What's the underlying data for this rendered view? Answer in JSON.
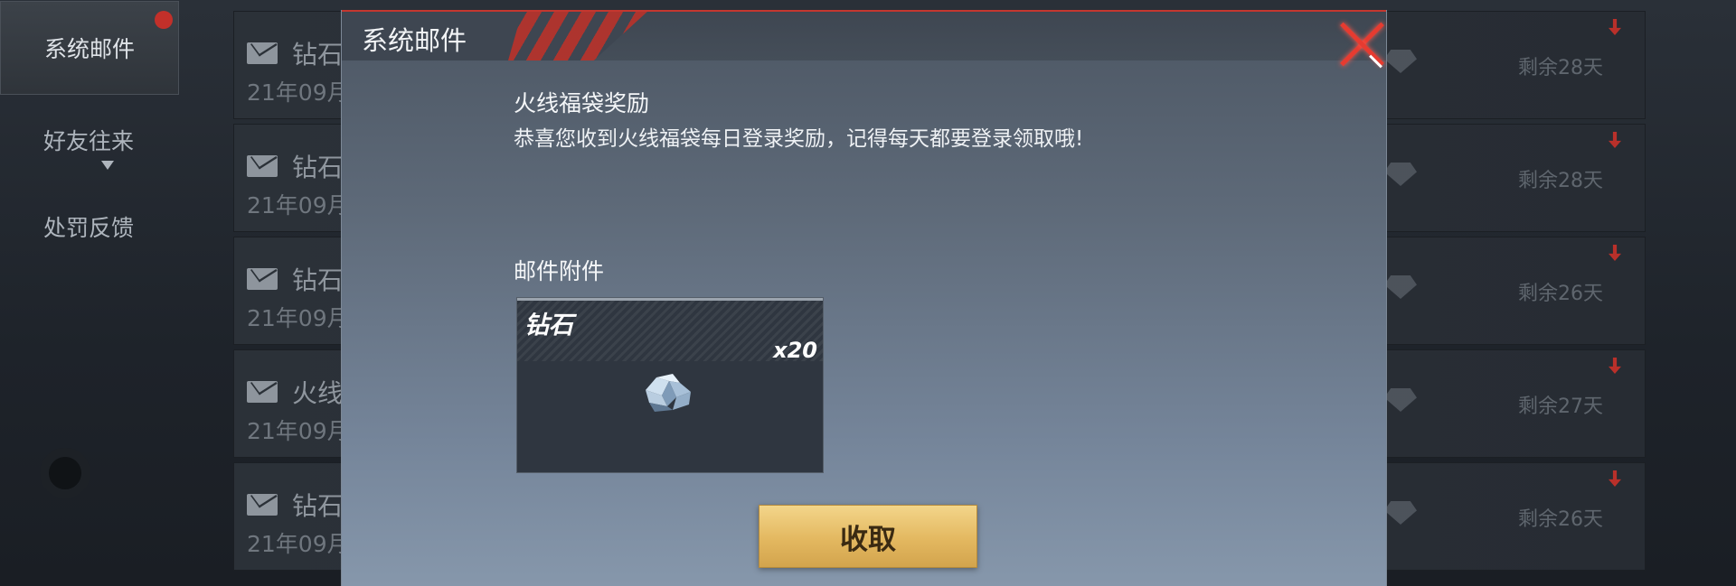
{
  "sidebar": {
    "items": [
      {
        "label": "系统邮件"
      },
      {
        "label": "好友往来"
      },
      {
        "label": "处罚反馈"
      }
    ]
  },
  "mail_list": {
    "rows": [
      {
        "title": "钻石",
        "date": "21年09月",
        "remain": "剩余28天"
      },
      {
        "title": "钻石",
        "date": "21年09月",
        "remain": "剩余28天"
      },
      {
        "title": "钻石",
        "date": "21年09月",
        "remain": "剩余26天"
      },
      {
        "title": "火线",
        "date": "21年09月",
        "remain": "剩余27天"
      },
      {
        "title": "钻石",
        "date": "21年09月",
        "remain": "剩余26天"
      }
    ]
  },
  "modal": {
    "title": "系统邮件",
    "subject": "火线福袋奖励",
    "body": "恭喜您收到火线福袋每日登录奖励，记得每天都要登录领取哦!",
    "attachment_label": "邮件附件",
    "item": {
      "name": "钻石",
      "quantity": "x20"
    },
    "collect_label": "收取"
  },
  "colors": {
    "accent_red": "#e63b30",
    "collect_gold": "#e3b860",
    "modal_bg": "#5e6a79"
  },
  "icons": [
    "mail-icon",
    "close-icon",
    "diamond-icon",
    "notification-flag-icon",
    "dropdown-arrow-icon"
  ]
}
